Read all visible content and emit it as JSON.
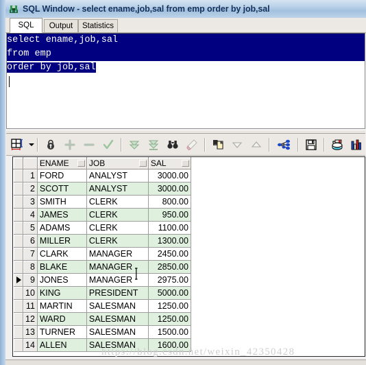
{
  "window": {
    "title": "SQL Window - select ename,job,sal from emp order by job,sal",
    "icon": "sql-window-icon"
  },
  "tabs": [
    {
      "label": "SQL",
      "active": true
    },
    {
      "label": "Output",
      "active": false
    },
    {
      "label": "Statistics",
      "active": false
    }
  ],
  "editor": {
    "lines": [
      "select ename,job,sal",
      "from emp",
      "order by job,sal"
    ],
    "selection_color": "#000080",
    "selection_text_color": "#ffffff",
    "all_selected": true
  },
  "toolbar": {
    "items": [
      {
        "name": "grid-layout-button",
        "glyph": "grid"
      },
      {
        "name": "grid-layout-dropdown",
        "glyph": "caret-down"
      },
      {
        "name": "separator-1",
        "glyph": "sep"
      },
      {
        "name": "lock-record-button",
        "glyph": "lock"
      },
      {
        "name": "insert-record-button",
        "glyph": "plus"
      },
      {
        "name": "delete-record-button",
        "glyph": "minus"
      },
      {
        "name": "post-record-button",
        "glyph": "check"
      },
      {
        "name": "separator-2",
        "glyph": "sep"
      },
      {
        "name": "fetch-next-page-button",
        "glyph": "double-chevron-down"
      },
      {
        "name": "fetch-last-page-button",
        "glyph": "chevron-down-bar"
      },
      {
        "name": "find-button",
        "glyph": "binoculars"
      },
      {
        "name": "clear-filter-button",
        "glyph": "eraser"
      },
      {
        "name": "separator-3",
        "glyph": "sep"
      },
      {
        "name": "copy-to-clipboard-button",
        "glyph": "copy-page"
      },
      {
        "name": "sort-descending-button",
        "glyph": "triangle-down"
      },
      {
        "name": "sort-ascending-button",
        "glyph": "triangle-up"
      },
      {
        "name": "separator-4",
        "glyph": "sep"
      },
      {
        "name": "explain-plan-button",
        "glyph": "node-network"
      },
      {
        "name": "separator-5",
        "glyph": "sep"
      },
      {
        "name": "save-button",
        "glyph": "floppy"
      },
      {
        "name": "separator-6",
        "glyph": "sep"
      },
      {
        "name": "export-data-button",
        "glyph": "database-export"
      },
      {
        "name": "chart-button",
        "glyph": "bar-chart"
      },
      {
        "name": "chart-dropdown",
        "glyph": "caret-down"
      }
    ]
  },
  "grid": {
    "columns": [
      "ENAME",
      "JOB",
      "SAL"
    ],
    "current_row": 9,
    "row_colors": {
      "odd": "#ffffff",
      "even": "#dff0df"
    },
    "rows": [
      {
        "n": "1",
        "ENAME": "FORD",
        "JOB": "ANALYST",
        "SAL": "3000.00"
      },
      {
        "n": "2",
        "ENAME": "SCOTT",
        "JOB": "ANALYST",
        "SAL": "3000.00"
      },
      {
        "n": "3",
        "ENAME": "SMITH",
        "JOB": "CLERK",
        "SAL": "800.00"
      },
      {
        "n": "4",
        "ENAME": "JAMES",
        "JOB": "CLERK",
        "SAL": "950.00"
      },
      {
        "n": "5",
        "ENAME": "ADAMS",
        "JOB": "CLERK",
        "SAL": "1100.00"
      },
      {
        "n": "6",
        "ENAME": "MILLER",
        "JOB": "CLERK",
        "SAL": "1300.00"
      },
      {
        "n": "7",
        "ENAME": "CLARK",
        "JOB": "MANAGER",
        "SAL": "2450.00"
      },
      {
        "n": "8",
        "ENAME": "BLAKE",
        "JOB": "MANAGER",
        "SAL": "2850.00"
      },
      {
        "n": "9",
        "ENAME": "JONES",
        "JOB": "MANAGER",
        "SAL": "2975.00"
      },
      {
        "n": "10",
        "ENAME": "KING",
        "JOB": "PRESIDENT",
        "SAL": "5000.00"
      },
      {
        "n": "11",
        "ENAME": "MARTIN",
        "JOB": "SALESMAN",
        "SAL": "1250.00"
      },
      {
        "n": "12",
        "ENAME": "WARD",
        "JOB": "SALESMAN",
        "SAL": "1250.00"
      },
      {
        "n": "13",
        "ENAME": "TURNER",
        "JOB": "SALESMAN",
        "SAL": "1500.00"
      },
      {
        "n": "14",
        "ENAME": "ALLEN",
        "JOB": "SALESMAN",
        "SAL": "1600.00"
      }
    ]
  },
  "watermark": {
    "text": "https://blog.csdn.net/weixin_42350428"
  }
}
